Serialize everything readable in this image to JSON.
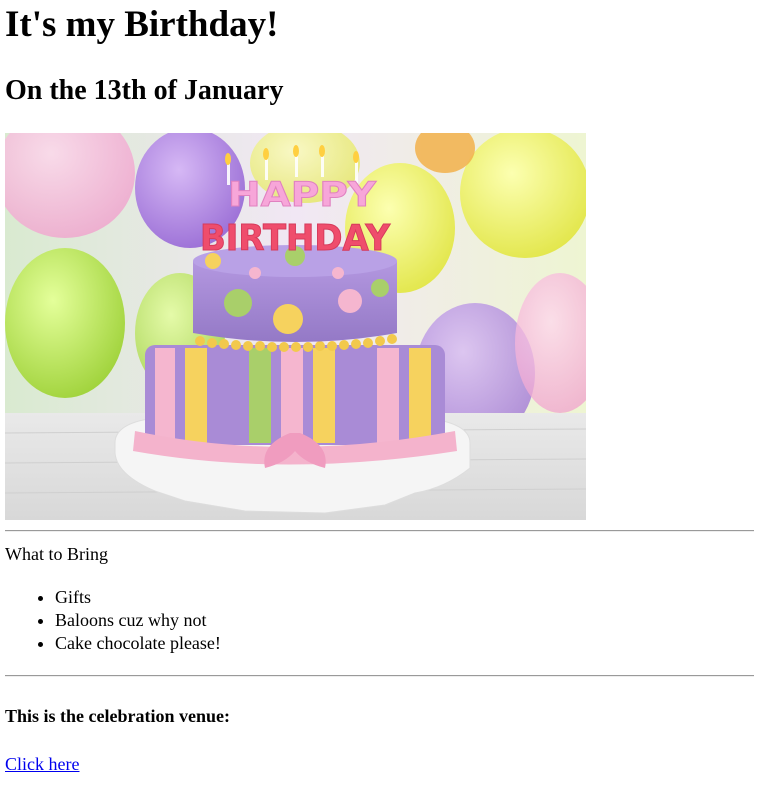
{
  "header": {
    "title": "It's my Birthday!",
    "subtitle": "On the 13th of January"
  },
  "image": {
    "cake_text_top": "HAPPY",
    "cake_text_bottom": "BIRTHDAY"
  },
  "bring": {
    "label": "What to Bring",
    "items": [
      {
        "text": "Gifts"
      },
      {
        "text": "Baloons cuz why not"
      },
      {
        "text": "Cake chocolate please!"
      }
    ]
  },
  "venue": {
    "label": "This is the celebration venue:",
    "link_text": "Click here"
  },
  "colors": {
    "link": "#0000ee",
    "cake_purple": "#a98bd6",
    "cake_pink": "#f5b6cf",
    "cake_yellow": "#f6d25e",
    "cake_green": "#a9cf6a"
  }
}
